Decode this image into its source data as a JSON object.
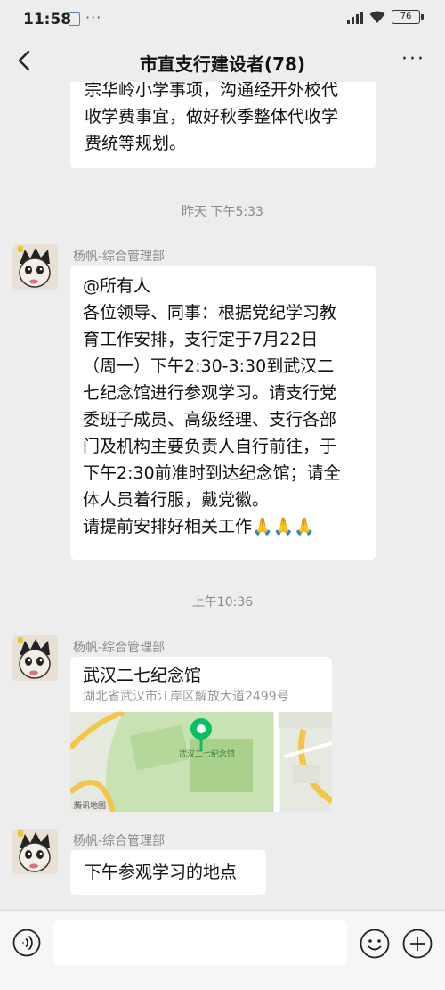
{
  "status_bar": {
    "time": "11:58",
    "notif_glyph": "☒",
    "battery": "76"
  },
  "header": {
    "title": "市直支行建设者(78)"
  },
  "messages": {
    "prev_bubble_lines": [
      "宗华岭小学事项，沟通经开外校代",
      "收学费事宜，做好秋季整体代收学",
      "费统等规划。"
    ],
    "timestamp_1": "昨天 下午5:33",
    "msg1": {
      "sender": "杨帆-综合管理部",
      "lines": [
        "@所有人",
        "各位领导、同事：根据党纪学习教",
        "育工作安排，支行定于7月22日",
        "（周一）下午2:30-3:30到武汉二",
        "七纪念馆进行参观学习。请支行党",
        "委班子成员、高级经理、支行各部",
        "门及机构主要负责人自行前往，于",
        "下午2:30前准时到达纪念馆；请全",
        "体人员着行服，戴党徽。",
        "请提前安排好相关工作🙏🙏🙏"
      ]
    },
    "timestamp_2": "上午10:36",
    "msg2": {
      "sender": "杨帆-综合管理部",
      "location_name": "武汉二七纪念馆",
      "location_address": "湖北省武汉市江岸区解放大道2499号",
      "map_credit": "腾讯地图",
      "map_label": "武汉二七纪念馆"
    },
    "msg3": {
      "sender": "杨帆-综合管理部",
      "text": "下午参观学习的地点"
    }
  },
  "icons": {
    "back": "chevron-left-icon",
    "more": "more-icon",
    "voice": "voice-icon",
    "emoji": "emoji-icon",
    "plus": "plus-icon"
  }
}
